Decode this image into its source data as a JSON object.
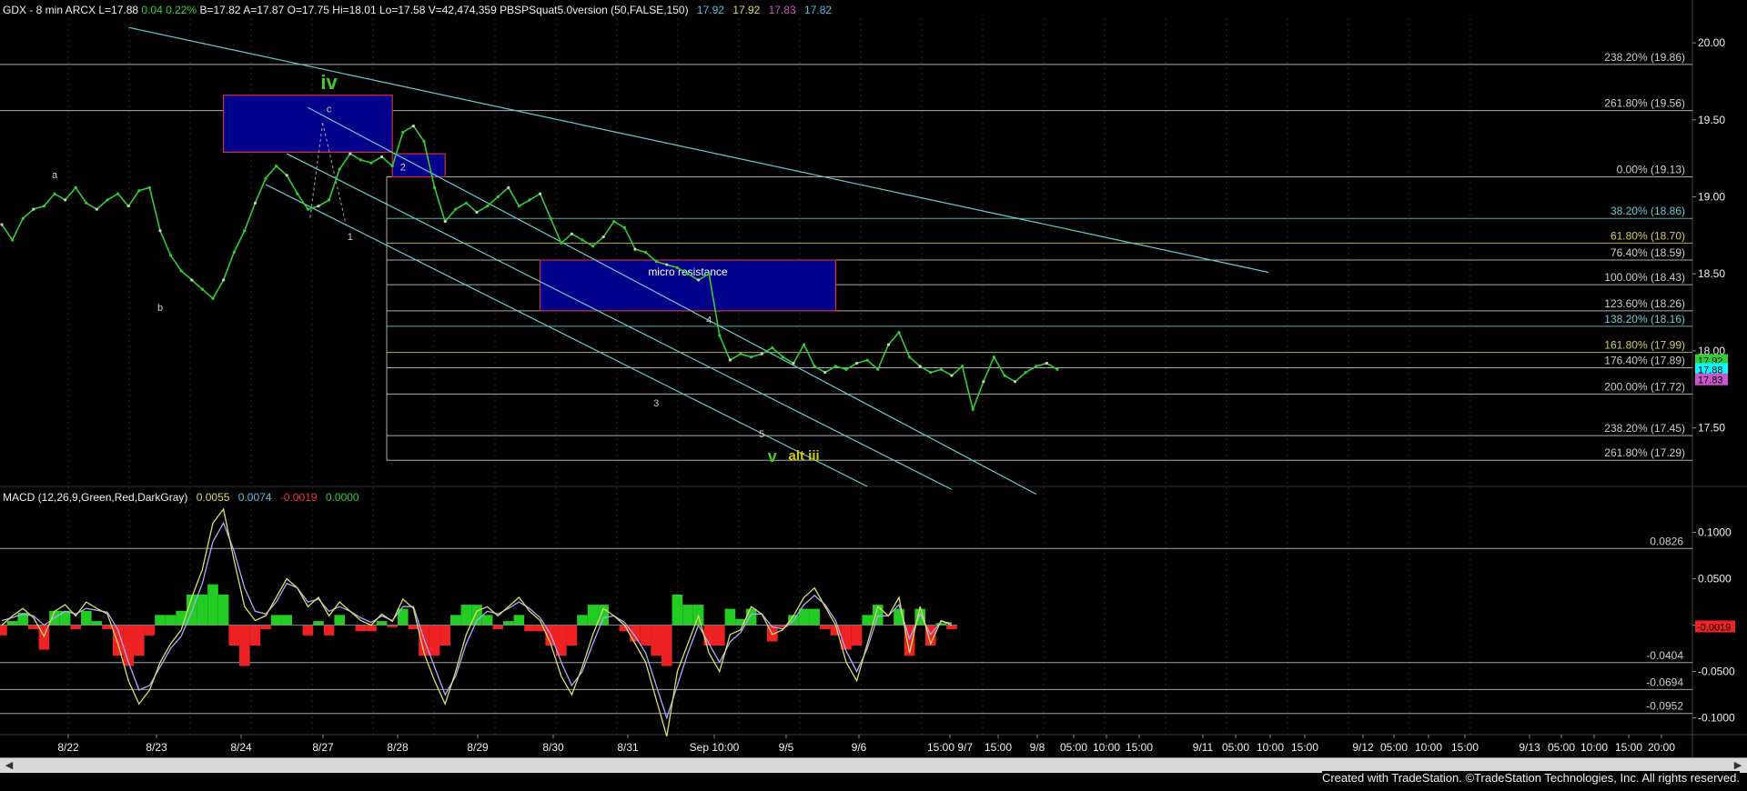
{
  "header": {
    "prefix": "GDX - 8 min  ARCX  L=17.88",
    "change": "0.04  0.22%",
    "quote": "B=17.82  A=17.87  O=17.75  Hi=18.01  Lo=17.58  V=42,474,359  PBSPSquat5.0version (50,FALSE,150)",
    "ind1": "17.92",
    "ind2": "17.92",
    "ind3": "17.83",
    "ind4": "17.82"
  },
  "macd_header": {
    "name": "MACD (12,26,9,Green,Red,DarkGray)",
    "v1": "0.0055",
    "v2": "0.0074",
    "v3": "-0.0019",
    "v4": "0.0000"
  },
  "colors": {
    "background": "#000000",
    "price_up": "#33cc33",
    "fib": "#cccccc",
    "trendline": "#66cccc",
    "box_fill": "#00008b",
    "box_border": "#cc3333",
    "wave_label": "#44cc22",
    "alt_label": "#cccc00",
    "macd_line": "#dddd66",
    "signal_line": "#aaaaff",
    "hist_pos": "#22cc22",
    "hist_neg": "#ee2222",
    "header_green": "#33cc33",
    "header_cyan": "#55bbdd",
    "header_yellow": "#dddd55",
    "header_magenta": "#cc55cc",
    "header_red": "#ee3333"
  },
  "chart_data": [
    {
      "type": "line",
      "panel": "price",
      "ylim": [
        17.12,
        20.16
      ],
      "y_ticks": [
        "20.00",
        "19.50",
        "19.00",
        "18.50",
        "18.00",
        "17.50"
      ],
      "x_labels": [
        "8/22",
        "8/23",
        "8/24",
        "8/27",
        "8/28",
        "8/29",
        "8/30",
        "8/31",
        "Sep 10:00",
        "9/5",
        "9/6",
        "15:00 9/7",
        "15:00",
        "9/8",
        "05:00",
        "10:00",
        "15:00",
        "9/11",
        "05:00",
        "10:00",
        "15:00",
        "9/12",
        "05:00",
        "10:00",
        "15:00",
        "9/13",
        "05:00",
        "10:00",
        "15:00",
        "20:00"
      ],
      "series": [
        {
          "values": [
            18.82,
            18.72,
            18.86,
            18.92,
            18.94,
            19.02,
            18.98,
            19.06,
            18.96,
            18.92,
            18.98,
            19.02,
            18.94,
            19.04,
            19.06,
            18.78,
            18.62,
            18.52,
            18.46,
            18.4,
            18.34,
            18.46,
            18.64,
            18.78,
            18.96,
            19.12,
            19.2,
            19.14,
            19.02,
            18.92,
            18.94,
            18.98,
            19.18,
            19.28,
            19.24,
            19.22,
            19.26,
            19.2,
            19.42,
            19.46,
            19.36,
            19.06,
            18.84,
            18.92,
            18.96,
            18.9,
            18.94,
            19.0,
            19.06,
            18.94,
            18.98,
            19.02,
            18.86,
            18.7,
            18.76,
            18.72,
            18.68,
            18.74,
            18.84,
            18.8,
            18.66,
            18.64,
            18.58,
            18.56,
            18.54,
            18.5,
            18.46,
            18.5,
            18.1,
            17.94,
            17.98,
            17.96,
            17.98,
            18.02,
            17.96,
            17.92,
            18.04,
            17.9,
            17.86,
            17.9,
            17.88,
            17.92,
            17.94,
            17.88,
            18.04,
            18.12,
            17.96,
            17.9,
            17.86,
            17.88,
            17.84,
            17.9,
            17.62,
            17.8,
            17.96,
            17.84,
            17.8,
            17.86,
            17.9,
            17.92,
            17.88
          ]
        }
      ],
      "fib_levels": [
        {
          "label": "238.20% (19.86)",
          "value": 19.86,
          "color": "#cccccc"
        },
        {
          "label": "261.80% (19.56)",
          "value": 19.56,
          "color": "#cccccc"
        },
        {
          "label": "0.00% (19.13)",
          "value": 19.13,
          "color": "#cccccc"
        },
        {
          "label": "38.20% (18.86)",
          "value": 18.86,
          "color": "#66cccc"
        },
        {
          "label": "61.80% (18.70)",
          "value": 18.7,
          "color": "#cccc66"
        },
        {
          "label": "76.40% (18.59)",
          "value": 18.59,
          "color": "#cccccc"
        },
        {
          "label": "100.00% (18.43)",
          "value": 18.43,
          "color": "#cccccc"
        },
        {
          "label": "123.60% (18.26)",
          "value": 18.26,
          "color": "#cccccc"
        },
        {
          "label": "138.20% (18.16)",
          "value": 18.16,
          "color": "#66cccc"
        },
        {
          "label": "161.80% (17.99)",
          "value": 17.99,
          "color": "#cccc66"
        },
        {
          "label": "176.40% (17.89)",
          "value": 17.89,
          "color": "#cccccc"
        },
        {
          "label": "200.00% (17.72)",
          "value": 17.72,
          "color": "#cccccc"
        },
        {
          "label": "238.20% (17.45)",
          "value": 17.45,
          "color": "#cccccc"
        },
        {
          "label": "261.80% (17.29)",
          "value": 17.29,
          "color": "#cccccc"
        }
      ],
      "price_tags": [
        {
          "value": "17.92",
          "color": "#33cc33",
          "price": 17.92
        },
        {
          "value": "17.88",
          "color": "#00ffff",
          "price": 17.88
        },
        {
          "value": "17.83",
          "color": "#cc55cc",
          "price": 17.83
        }
      ],
      "zones": [
        {
          "label": "",
          "x_start": 21,
          "x_end": 37,
          "y_low": 19.29,
          "y_high": 19.66
        },
        {
          "label": "",
          "x_start": 37,
          "x_end": 42,
          "y_low": 19.13,
          "y_high": 19.28
        },
        {
          "label": "micro resistance",
          "x_start": 51,
          "x_end": 79,
          "y_low": 18.26,
          "y_high": 18.59
        }
      ],
      "trendlines": [
        {
          "from": [
            12,
            20.1
          ],
          "to": [
            120,
            18.51
          ]
        },
        {
          "from": [
            29,
            19.58
          ],
          "to": [
            98,
            17.07
          ]
        },
        {
          "from": [
            27,
            19.28
          ],
          "to": [
            90,
            17.1
          ]
        },
        {
          "from": [
            25,
            19.08
          ],
          "to": [
            82,
            17.12
          ]
        }
      ],
      "annotations": [
        {
          "text": "iv",
          "x": 31,
          "y": 19.7,
          "color": "#44cc22",
          "size": 22
        },
        {
          "text": "c",
          "x": 31,
          "y": 19.55,
          "color": "#cccccc",
          "size": 11
        },
        {
          "text": "a",
          "x": 5,
          "y": 19.12,
          "color": "#cccccc",
          "size": 11
        },
        {
          "text": "b",
          "x": 15,
          "y": 18.26,
          "color": "#cccccc",
          "size": 11
        },
        {
          "text": "1",
          "x": 33,
          "y": 18.72,
          "color": "#cccccc",
          "size": 11
        },
        {
          "text": "2",
          "x": 38,
          "y": 19.17,
          "color": "#cccccc",
          "size": 11
        },
        {
          "text": "3",
          "x": 62,
          "y": 17.64,
          "color": "#cccccc",
          "size": 11
        },
        {
          "text": "4",
          "x": 67,
          "y": 18.18,
          "color": "#cccccc",
          "size": 11
        },
        {
          "text": "5",
          "x": 72,
          "y": 17.44,
          "color": "#cccccc",
          "size": 11
        },
        {
          "text": "v",
          "x": 73,
          "y": 17.28,
          "color": "#44cc22",
          "size": 18
        },
        {
          "text": "alt iii",
          "x": 76,
          "y": 17.29,
          "color": "#cccc00",
          "size": 15
        }
      ]
    },
    {
      "type": "line",
      "panel": "macd",
      "ylim": [
        -0.118,
        0.125
      ],
      "y_ticks": [
        "0.1000",
        "0.0500",
        "0.0000",
        "-0.0500",
        "-0.1000"
      ],
      "levels": [
        {
          "label": "0.0826",
          "value": 0.0826
        },
        {
          "label": "-0.0404",
          "value": -0.0404
        },
        {
          "label": "-0.0694",
          "value": -0.0694
        },
        {
          "label": "-0.0952",
          "value": -0.0952
        }
      ],
      "last_tag": {
        "label": "-0.0019",
        "value": -0.0019
      },
      "series": [
        {
          "name": "MACD",
          "values": [
            0.0,
            0.01,
            0.018,
            0.008,
            -0.012,
            0.015,
            0.022,
            0.01,
            0.025,
            0.018,
            0.012,
            -0.02,
            -0.06,
            -0.085,
            -0.07,
            -0.04,
            -0.02,
            -0.005,
            0.03,
            0.06,
            0.11,
            0.125,
            0.07,
            0.02,
            0.005,
            0.01,
            0.03,
            0.05,
            0.04,
            0.02,
            0.03,
            0.01,
            0.025,
            0.015,
            0.005,
            0.0,
            0.012,
            0.004,
            0.028,
            0.018,
            -0.03,
            -0.06,
            -0.085,
            -0.05,
            -0.01,
            0.015,
            0.02,
            0.01,
            0.02,
            0.03,
            0.015,
            0.005,
            -0.02,
            -0.055,
            -0.075,
            -0.045,
            -0.01,
            0.018,
            0.01,
            0.0,
            -0.02,
            -0.04,
            -0.08,
            -0.12,
            -0.05,
            -0.02,
            0.01,
            -0.03,
            -0.05,
            -0.01,
            -0.005,
            0.02,
            0.012,
            -0.01,
            -0.005,
            0.01,
            0.03,
            0.04,
            0.02,
            0.0,
            -0.04,
            -0.06,
            -0.02,
            0.02,
            0.01,
            0.03,
            -0.03,
            0.02,
            -0.02,
            0.005,
            0.0
          ]
        },
        {
          "name": "Signal",
          "values": [
            0.005,
            0.008,
            0.012,
            0.01,
            0.0,
            0.008,
            0.015,
            0.012,
            0.018,
            0.016,
            0.014,
            -0.005,
            -0.04,
            -0.07,
            -0.065,
            -0.045,
            -0.025,
            -0.012,
            0.015,
            0.045,
            0.09,
            0.11,
            0.08,
            0.04,
            0.015,
            0.012,
            0.025,
            0.045,
            0.04,
            0.025,
            0.028,
            0.015,
            0.02,
            0.015,
            0.008,
            0.003,
            0.01,
            0.005,
            0.02,
            0.02,
            -0.015,
            -0.045,
            -0.075,
            -0.055,
            -0.02,
            0.005,
            0.015,
            0.012,
            0.018,
            0.025,
            0.018,
            0.008,
            -0.01,
            -0.04,
            -0.065,
            -0.05,
            -0.02,
            0.008,
            0.01,
            0.003,
            -0.012,
            -0.03,
            -0.065,
            -0.1,
            -0.065,
            -0.03,
            0.0,
            -0.02,
            -0.04,
            -0.018,
            -0.008,
            0.012,
            0.012,
            -0.002,
            -0.004,
            0.005,
            0.022,
            0.032,
            0.022,
            0.005,
            -0.028,
            -0.05,
            -0.025,
            0.01,
            0.01,
            0.022,
            -0.015,
            0.012,
            -0.01,
            0.004,
            0.002
          ]
        }
      ]
    }
  ],
  "footer": "Created with TradeStation. ©TradeStation Technologies, Inc. All rights reserved."
}
